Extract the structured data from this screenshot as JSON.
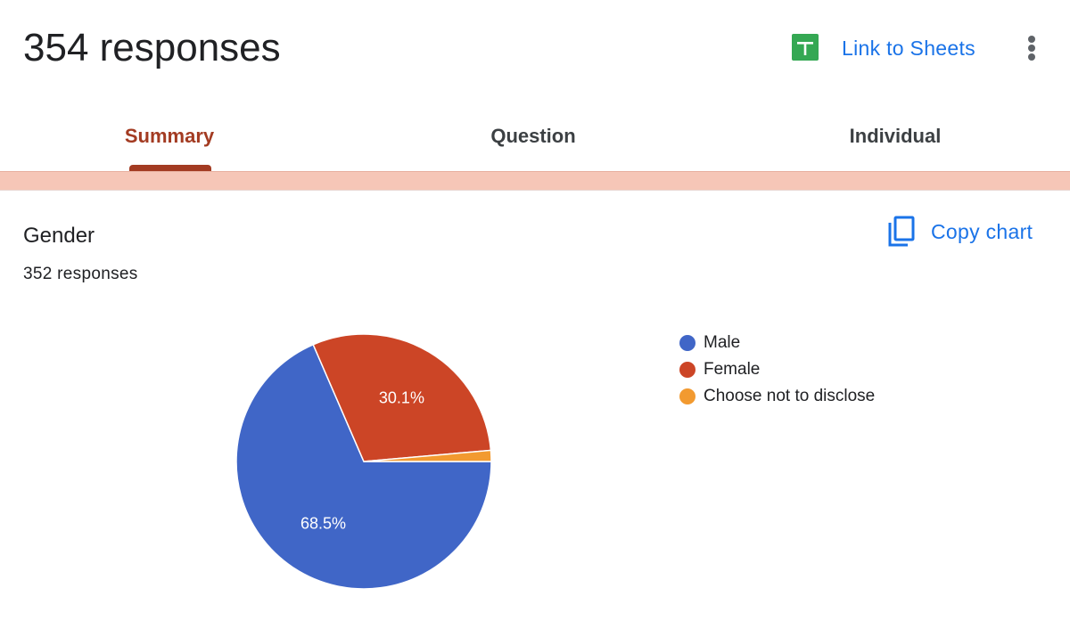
{
  "header": {
    "title": "354 responses",
    "sheets_link": "Link to Sheets",
    "sheets_icon": "google-sheets-icon",
    "more_icon": "more-vert-icon"
  },
  "tabs": [
    {
      "label": "Summary",
      "active": true
    },
    {
      "label": "Question",
      "active": false
    },
    {
      "label": "Individual",
      "active": false
    }
  ],
  "question": {
    "title": "Gender",
    "response_count": "352 responses",
    "copy_chart": "Copy chart",
    "copy_icon": "copy-icon"
  },
  "colors": {
    "accent": "#a33b22",
    "link": "#1a73e8",
    "band": "#f6c6b7"
  },
  "chart_data": {
    "type": "pie",
    "categories": [
      "Male",
      "Female",
      "Choose not to disclose"
    ],
    "values": [
      68.5,
      30.1,
      1.4
    ],
    "labels": [
      "68.5%",
      "30.1%",
      ""
    ],
    "colors": [
      "#4066c7",
      "#cc4526",
      "#f29a30"
    ],
    "legend_position": "right"
  }
}
